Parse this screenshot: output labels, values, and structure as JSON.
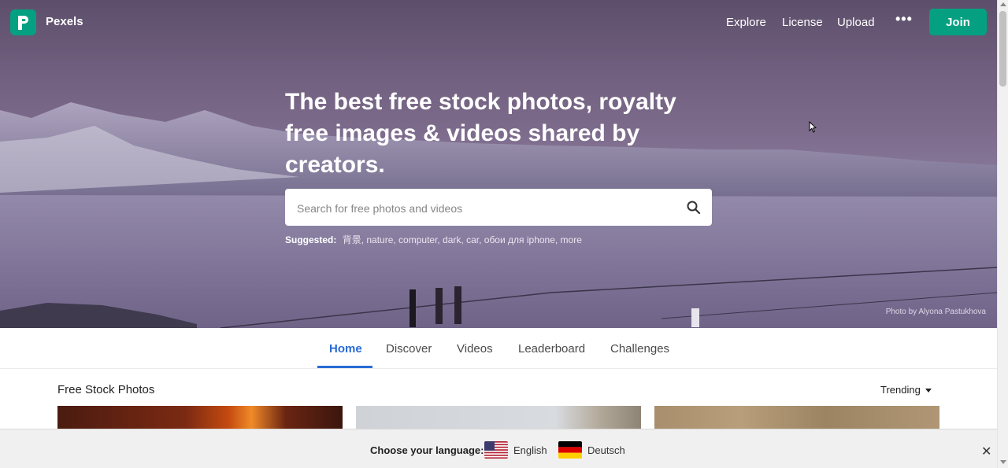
{
  "header": {
    "brand": "Pexels",
    "nav": [
      "Explore",
      "License",
      "Upload"
    ],
    "more": "•••",
    "join_label": "Join"
  },
  "hero": {
    "headline": "The best free stock photos, royalty free images & videos shared by creators.",
    "search_placeholder": "Search for free photos and videos",
    "suggested_label": "Suggested:",
    "suggestions": "背景, nature, computer, dark, car, обои для iphone, more",
    "credit": "Photo by Alyona Pastukhova"
  },
  "tabs": [
    "Home",
    "Discover",
    "Videos",
    "Leaderboard",
    "Challenges"
  ],
  "main": {
    "section_title": "Free Stock Photos",
    "sort_label": "Trending"
  },
  "language_bar": {
    "label": "Choose your language:",
    "languages": [
      "English",
      "Deutsch"
    ],
    "close": "✕"
  },
  "colors": {
    "brand_green": "#05a081",
    "active_tab": "#2a6bd6"
  }
}
